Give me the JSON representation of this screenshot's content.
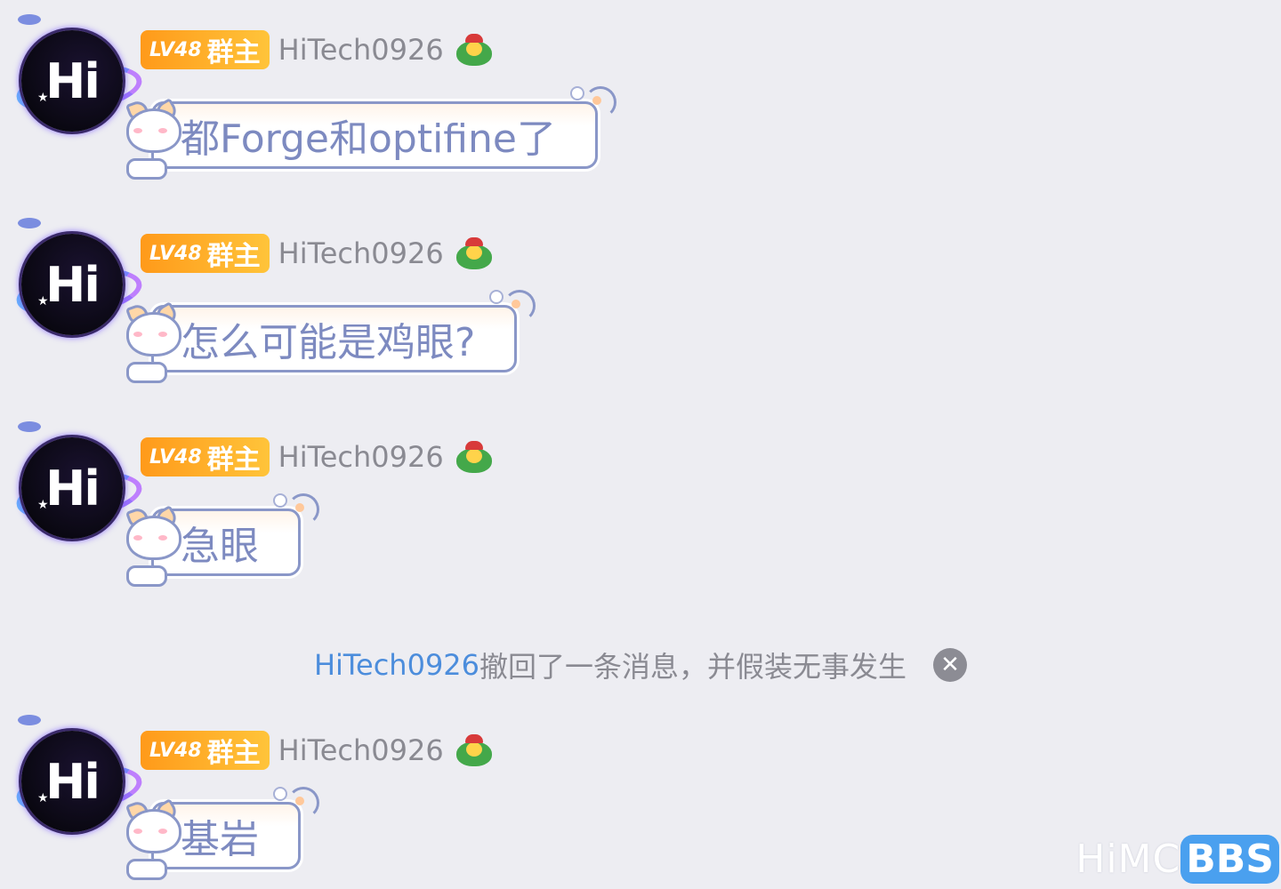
{
  "messages": [
    {
      "badge_level": "LV48",
      "badge_role": "群主",
      "username": "HiTech0926",
      "avatar_text": "Hi",
      "text": "都Forge和optifine了"
    },
    {
      "badge_level": "LV48",
      "badge_role": "群主",
      "username": "HiTech0926",
      "avatar_text": "Hi",
      "text": "怎么可能是鸡眼?"
    },
    {
      "badge_level": "LV48",
      "badge_role": "群主",
      "username": "HiTech0926",
      "avatar_text": "Hi",
      "text": "急眼"
    },
    {
      "badge_level": "LV48",
      "badge_role": "群主",
      "username": "HiTech0926",
      "avatar_text": "Hi",
      "text": "基岩"
    }
  ],
  "recall_notice": {
    "user": "HiTech0926",
    "text": "撤回了一条消息，并假装无事发生",
    "close_icon": "close-icon"
  },
  "watermark": {
    "left": "HiMC",
    "right": "BBS"
  },
  "colors": {
    "background": "#ededf2",
    "badge_gradient_start": "#ff9a1a",
    "badge_gradient_end": "#ffc43a",
    "username": "#8a8a92",
    "bubble_text": "#7d8ac0",
    "bubble_border": "#8a97c8",
    "notice_user": "#4c8ddc",
    "watermark_bbs": "#4aa0ef"
  },
  "icons": {
    "avatar": "hi-planet-avatar",
    "user_emoji": "green-chick-emoji",
    "bubble_decoration": "cat-bubble-frame"
  }
}
